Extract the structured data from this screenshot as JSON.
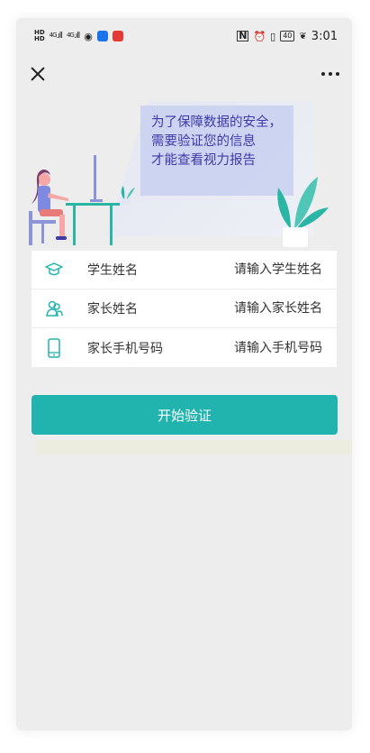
{
  "status_bar": {
    "left_tags": [
      "HD",
      "HD"
    ],
    "signal_a": "4G",
    "signal_b": "4G",
    "nfc": "N",
    "battery": "40",
    "time": "3:01"
  },
  "hero": {
    "line1": "为了保障数据的安全，",
    "line2": "需要验证您的信息",
    "line3": "才能查看视力报告"
  },
  "form": {
    "rows": [
      {
        "label": "学生姓名",
        "placeholder": "请输入学生姓名",
        "icon": "graduation-cap-icon"
      },
      {
        "label": "家长姓名",
        "placeholder": "请输入家长姓名",
        "icon": "parents-icon"
      },
      {
        "label": "家长手机号码",
        "placeholder": "请输入手机号码",
        "icon": "phone-icon"
      }
    ]
  },
  "submit": {
    "label": "开始验证"
  },
  "colors": {
    "accent": "#21b3ad",
    "hero_text": "#3c3aa8",
    "background": "#ededed"
  }
}
